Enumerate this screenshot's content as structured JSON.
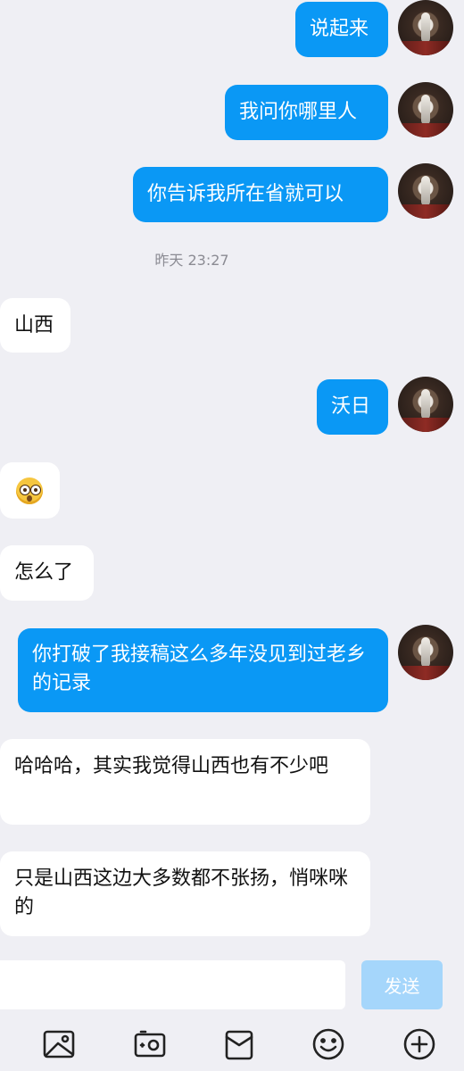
{
  "messages": [
    {
      "side": "out",
      "text": "说起来"
    },
    {
      "side": "out",
      "text": "我问你哪里人"
    },
    {
      "side": "out",
      "text": "你告诉我所在省就可以"
    },
    {
      "side": "in",
      "text": "山西"
    },
    {
      "side": "out",
      "text": "沃日"
    },
    {
      "side": "in",
      "text": "",
      "emoji": "shocked-face"
    },
    {
      "side": "in",
      "text": "怎么了"
    },
    {
      "side": "out",
      "text": "你打破了我接稿这么多年没见到过老乡的记录"
    },
    {
      "side": "in",
      "text": "哈哈哈，其实我觉得山西也有不少吧"
    },
    {
      "side": "in",
      "text": "只是山西这边大多数都不张扬，悄咪咪的"
    }
  ],
  "timestamp": "昨天 23:27",
  "composer": {
    "send_label": "发送",
    "input_value": ""
  },
  "toolbar": {
    "icons": [
      "image-icon",
      "camera-icon",
      "red-packet-icon",
      "emoji-icon",
      "plus-icon"
    ]
  },
  "colors": {
    "outgoing": "#0a98f5",
    "incoming": "#ffffff",
    "background": "#efeff4",
    "send_button": "#a5d6fb"
  }
}
